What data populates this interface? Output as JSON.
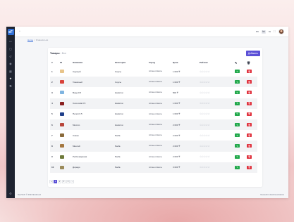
{
  "colors": {
    "accent": "#5a4fd6",
    "edit": "#20a84a",
    "delete": "#e0323e",
    "sidebar": "#1e2330"
  },
  "topbar": {
    "menu_icon": "sidebar-toggle-icon",
    "lang_options": [
      "en",
      "kk",
      "ru"
    ],
    "lang_selected": "kk"
  },
  "breadcrumb": {
    "home": "Home",
    "separator": "/",
    "current": "Products List"
  },
  "sidebar": {
    "logo": "eF",
    "items": [
      {
        "icon": "dashboard-icon",
        "glyph": "▭"
      },
      {
        "icon": "folder-icon",
        "glyph": "▢"
      },
      {
        "icon": "history-icon",
        "glyph": "↺"
      },
      {
        "icon": "location-icon",
        "glyph": "◉"
      },
      {
        "icon": "grid-icon",
        "glyph": "▦"
      },
      {
        "icon": "star-icon",
        "glyph": "★",
        "active": true
      },
      {
        "icon": "bookmark-icon",
        "glyph": "⧉"
      }
    ],
    "bottom_icon": "settings-icon"
  },
  "card": {
    "title": "Товары",
    "title_sep": " › ",
    "subtitle": "Все",
    "add_label": "Добавить"
  },
  "table": {
    "headers": {
      "num": "#",
      "id": "ID",
      "name": "Название",
      "category": "Категория",
      "city": "Город",
      "price": "Цена",
      "rating": "Рейтинг"
    },
    "rows": [
      {
        "n": "1",
        "name": "Сырный",
        "category": "Соусы",
        "city": "Астана Алматы",
        "price": "1 000 ₸",
        "img": "#e8c48a"
      },
      {
        "n": "2",
        "name": "Томатный",
        "category": "Соусы",
        "city": "Астана Алматы",
        "price": "1 000 ₸",
        "img": "#d9433a"
      },
      {
        "n": "3",
        "name": "Вода 0.5",
        "category": "Напитки",
        "city": "Астана Алматы",
        "price": "500 ₸",
        "img": "#7fb4e0"
      },
      {
        "n": "4",
        "name": "Coca cola 0.5",
        "category": "Напитки",
        "city": "Астана Алматы",
        "price": "1 000 ₸",
        "img": "#8a1f1f"
      },
      {
        "n": "5",
        "name": "Пепси 0.5",
        "category": "Напитки",
        "city": "Астана Алматы",
        "price": "1 000 ₸",
        "img": "#1f3f8a"
      },
      {
        "n": "6",
        "name": "Мохито",
        "category": "Напитки",
        "city": "Астана Алматы",
        "price": "2 000 ₸",
        "img": "#b8453a"
      },
      {
        "n": "7",
        "name": "Сазан",
        "category": "Рыба",
        "city": "Астана Алматы",
        "price": "2 000 ₸",
        "img": "#8a6a3a"
      },
      {
        "n": "8",
        "name": "Минтай",
        "category": "Рыба",
        "city": "Астана Алматы",
        "price": "2 000 ₸",
        "img": "#a4773f"
      },
      {
        "n": "9",
        "name": "Рыба жареная",
        "category": "Рыба",
        "city": "Астана Алматы",
        "price": "2 000 ₸",
        "img": "#6e7a3a"
      },
      {
        "n": "10",
        "name": "Дорадо",
        "category": "Рыба",
        "city": "Астана Алматы",
        "price": "3 000 ₸",
        "img": "#9a8a5a"
      }
    ],
    "rating_stars": "☆☆☆☆☆"
  },
  "pagination": {
    "prev": "«",
    "pages": [
      "1",
      "2",
      "3",
      "4"
    ],
    "active": "1",
    "next": "→"
  },
  "footer": {
    "left": "NeoTech © 2024 EcoFood",
    "right": "Neotech & EcoFood Admin"
  }
}
